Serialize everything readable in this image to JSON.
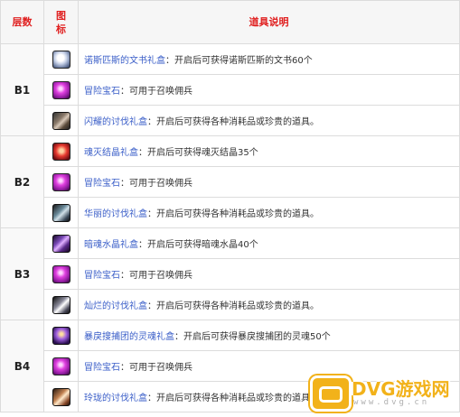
{
  "header": {
    "layer": "层数",
    "icon": "图\n标",
    "icon_line1": "图",
    "icon_line2": "标",
    "description": "道具说明"
  },
  "groups": [
    {
      "layer": "B1",
      "rows": [
        {
          "icon": "book-icon",
          "name": "诺斯匹斯的文书礼盒",
          "text": "：开启后可获得诺斯匹斯的文书60个"
        },
        {
          "icon": "gem-icon",
          "name": "冒险宝石",
          "text": "：可用于召唤佣兵"
        },
        {
          "icon": "chest-icon",
          "name": "闪耀的讨伐礼盒",
          "text": "：开启后可获得各种消耗品或珍贵的道具。"
        }
      ]
    },
    {
      "layer": "B2",
      "rows": [
        {
          "icon": "crystal-icon",
          "name": "魂灭结晶礼盒",
          "text": "：开启后可获得魂灭结晶35个"
        },
        {
          "icon": "gem-icon",
          "name": "冒险宝石",
          "text": "：可用于召唤佣兵"
        },
        {
          "icon": "chest-icon",
          "name": "华丽的讨伐礼盒",
          "text": "：开启后可获得各种消耗品或珍贵的道具。"
        }
      ]
    },
    {
      "layer": "B3",
      "rows": [
        {
          "icon": "dark-crystal-icon",
          "name": "暗魂水晶礼盒",
          "text": "：开启后可获得暗魂水晶40个"
        },
        {
          "icon": "gem-icon",
          "name": "冒险宝石",
          "text": "：可用于召唤佣兵"
        },
        {
          "icon": "chest-icon",
          "name": "灿烂的讨伐礼盒",
          "text": "：开启后可获得各种消耗品或珍贵的道具。"
        }
      ]
    },
    {
      "layer": "B4",
      "rows": [
        {
          "icon": "soul-icon",
          "name": "暴戾搜捕团的灵魂礼盒",
          "text": "：开启后可获得暴戾搜捕团的灵魂50个"
        },
        {
          "icon": "gem-icon",
          "name": "冒险宝石",
          "text": "：可用于召唤佣兵"
        },
        {
          "icon": "chest-icon",
          "name": "玲珑的讨伐礼盒",
          "text": "：开启后可获得各种消耗品或珍贵的道具。"
        }
      ]
    }
  ],
  "watermark": {
    "logo_text": "DVG游戏网",
    "url_text": "www.dvg.cn"
  },
  "colors": {
    "header_text": "#e02020",
    "item_name": "#3a5ec8",
    "watermark": "#f2b21a"
  }
}
